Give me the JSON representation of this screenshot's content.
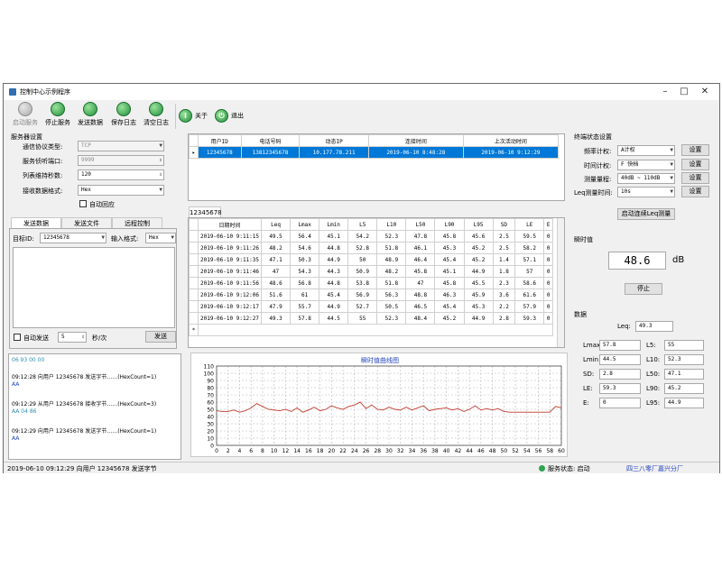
{
  "window": {
    "title": "控制中心示例程序",
    "controls": [
      "–",
      "□",
      "✕"
    ]
  },
  "toolbar": {
    "buttons": [
      {
        "label": "启动服务",
        "icon": "play-icon",
        "enabled": false
      },
      {
        "label": "停止服务",
        "icon": "stop-icon",
        "enabled": true
      },
      {
        "label": "发送数据",
        "icon": "send-icon",
        "enabled": true
      },
      {
        "label": "保存日志",
        "icon": "save-log-icon",
        "enabled": true
      },
      {
        "label": "清空日志",
        "icon": "clear-log-icon",
        "enabled": true
      }
    ],
    "about_label": "关于",
    "exit_label": "退出"
  },
  "server_settings": {
    "title": "服务器设置",
    "protocol_label": "通信协议类型:",
    "protocol_value": "TCP",
    "port_label": "服务侦听端口:",
    "port_value": "9999",
    "keep_label": "列表维持秒数:",
    "keep_value": "120",
    "recv_format_label": "接收数据格式:",
    "recv_format_value": "Hex",
    "auto_reply_label": "自动回应"
  },
  "send_tabs": {
    "tabs": [
      "发送数据",
      "发送文件",
      "远程控制"
    ],
    "target_id_label": "目标ID:",
    "target_id_value": "12345678",
    "input_format_label": "输入格式:",
    "input_format_value": "Hex",
    "auto_send_label": "自动发送",
    "interval_value": "5",
    "interval_unit": "秒/次",
    "send_button": "发送"
  },
  "log": {
    "lines": [
      {
        "text": "06 93 00 00",
        "color": "#2b8fb0"
      },
      {
        "text": "09:12:28 向用户 12345678 发送字节……(HexCount=1)",
        "color": "#000000",
        "accent": "#1f3fbf"
      },
      {
        "text": "AA",
        "color": "#1f3fbf"
      },
      {
        "text": "09:12:29 从用户 12345678 接收字节……(HexCount=3)",
        "color": "#000000",
        "accent": "#2b8fb0"
      },
      {
        "text": "AA 04 86",
        "color": "#2b8fb0"
      },
      {
        "text": "09:12:29 向用户 12345678 发送字节……(HexCount=1)",
        "color": "#000000",
        "accent": "#1f3fbf"
      },
      {
        "text": "AA",
        "color": "#1f3fbf"
      }
    ]
  },
  "users_table": {
    "columns": [
      "用户ID",
      "电话号码",
      "动态IP",
      "连接时间",
      "上次活动时间"
    ],
    "rows": [
      [
        "12345678",
        "13812345678",
        "10.177.78.211",
        "2019-06-10 8:48:28",
        "2019-06-10 9:12:29"
      ]
    ]
  },
  "data_tab_label": "12345678",
  "data_table": {
    "columns": [
      "日期时间",
      "Leq",
      "Lmax",
      "Lmin",
      "L5",
      "L10",
      "L50",
      "L90",
      "L95",
      "SD",
      "LE",
      "E"
    ],
    "rows": [
      [
        "2019-06-10 9:11:15",
        "49.5",
        "56.4",
        "45.1",
        "54.2",
        "52.3",
        "47.8",
        "45.8",
        "45.6",
        "2.5",
        "59.5",
        "0"
      ],
      [
        "2019-06-10 9:11:26",
        "48.2",
        "54.6",
        "44.8",
        "52.8",
        "51.8",
        "46.1",
        "45.3",
        "45.2",
        "2.5",
        "58.2",
        "0"
      ],
      [
        "2019-06-10 9:11:35",
        "47.1",
        "50.3",
        "44.9",
        "50",
        "48.9",
        "46.4",
        "45.4",
        "45.2",
        "1.4",
        "57.1",
        "0"
      ],
      [
        "2019-06-10 9:11:46",
        "47",
        "54.3",
        "44.3",
        "50.9",
        "48.2",
        "45.8",
        "45.1",
        "44.9",
        "1.8",
        "57",
        "0"
      ],
      [
        "2019-06-10 9:11:56",
        "48.6",
        "56.8",
        "44.8",
        "53.8",
        "51.8",
        "47",
        "45.8",
        "45.5",
        "2.3",
        "58.6",
        "0"
      ],
      [
        "2019-06-10 9:12:06",
        "51.6",
        "61",
        "45.4",
        "56.9",
        "56.3",
        "48.8",
        "46.3",
        "45.9",
        "3.6",
        "61.6",
        "0"
      ],
      [
        "2019-06-10 9:12:17",
        "47.9",
        "55.7",
        "44.9",
        "52.7",
        "50.5",
        "46.5",
        "45.4",
        "45.3",
        "2.2",
        "57.9",
        "0"
      ],
      [
        "2019-06-10 9:12:27",
        "49.3",
        "57.8",
        "44.5",
        "55",
        "52.3",
        "48.4",
        "45.2",
        "44.9",
        "2.8",
        "59.3",
        "0"
      ]
    ],
    "new_row_marker": "*"
  },
  "terminal": {
    "title": "终端状态设置",
    "freq_label": "频率计权:",
    "freq_value": "A计权",
    "time_label": "时间计权:",
    "time_value": "F  快档",
    "range_label": "测量量程:",
    "range_value": "40dB ~ 110dB",
    "leq_time_label": "Leq测量时间:",
    "leq_time_value": "10s",
    "set_button": "设置",
    "start_leq_button": "启动连续Leq测量"
  },
  "instant": {
    "title": "瞬时值",
    "value": "48.6",
    "unit": "dB",
    "stop_button": "停止"
  },
  "stats": {
    "title": "数据",
    "leq_label": "Leq:",
    "leq_value": "49.3",
    "left": [
      {
        "label": "Lmax:",
        "value": "57.8"
      },
      {
        "label": "Lmin:",
        "value": "44.5"
      },
      {
        "label": "SD:",
        "value": "2.8"
      },
      {
        "label": "LE:",
        "value": "59.3"
      },
      {
        "label": "E:",
        "value": "0"
      }
    ],
    "right": [
      {
        "label": "L5:",
        "value": "55"
      },
      {
        "label": "L10:",
        "value": "52.3"
      },
      {
        "label": "L50:",
        "value": "47.1"
      },
      {
        "label": "L90:",
        "value": "45.2"
      },
      {
        "label": "L95:",
        "value": "44.9"
      }
    ]
  },
  "chart_data": {
    "type": "line",
    "title": "瞬时值曲线图",
    "xlabel": "",
    "ylabel": "",
    "xlim": [
      0,
      60
    ],
    "ylim": [
      0,
      110
    ],
    "xticks": [
      0,
      2,
      4,
      6,
      8,
      10,
      12,
      14,
      16,
      18,
      20,
      22,
      24,
      26,
      28,
      30,
      32,
      34,
      36,
      38,
      40,
      42,
      44,
      46,
      48,
      50,
      52,
      54,
      56,
      58,
      60
    ],
    "yticks": [
      0,
      10,
      20,
      30,
      40,
      50,
      60,
      70,
      80,
      90,
      100,
      110
    ],
    "grid": true,
    "line_color": "#c0392b",
    "series": [
      {
        "x": [
          0,
          1,
          2,
          3,
          4,
          5,
          6,
          7,
          8,
          9,
          10,
          11,
          12,
          13,
          14,
          15,
          16,
          17,
          18,
          19,
          20,
          21,
          22,
          23,
          24,
          25,
          26,
          27,
          28,
          29,
          30,
          31,
          32,
          33,
          34,
          35,
          36,
          37,
          38,
          39,
          40,
          41,
          42,
          43,
          44,
          45,
          46,
          47,
          48,
          49,
          50,
          51,
          52,
          53,
          54,
          55,
          56,
          57,
          58,
          59,
          60
        ],
        "y": [
          48,
          47,
          47,
          49,
          46,
          48,
          52,
          58,
          54,
          50,
          49,
          48,
          50,
          47,
          52,
          46,
          49,
          53,
          48,
          50,
          55,
          52,
          50,
          54,
          56,
          60,
          51,
          56,
          50,
          49,
          53,
          50,
          49,
          53,
          49,
          52,
          55,
          48,
          50,
          51,
          52,
          49,
          51,
          47,
          50,
          55,
          49,
          51,
          49,
          51,
          47,
          46,
          46,
          46,
          46,
          46,
          46,
          46,
          46,
          54,
          52
        ]
      }
    ]
  },
  "status": {
    "left_text": "2019-06-10 09:12:29 向用户 12345678 发送字节",
    "service_label": "服务状态: 启动",
    "company": "四三八零厂嘉兴分厂"
  }
}
